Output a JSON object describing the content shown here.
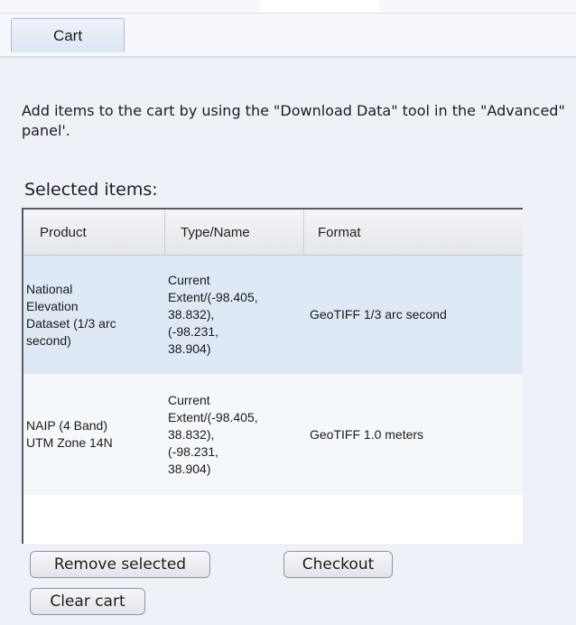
{
  "tabs": [
    {
      "label": "Cart",
      "active": true
    }
  ],
  "instructions": "Add items to the cart by using the \"Download Data\" tool in the \"Advanced\" panel'.",
  "selected_heading": "Selected items:",
  "grid": {
    "columns": [
      "Product",
      "Type/Name",
      "Format"
    ],
    "rows": [
      {
        "product": "National\nElevation\nDataset (1/3 arc\nsecond)",
        "type_name": "Current\nExtent/(-98.405,\n38.832),\n(-98.231,\n38.904)",
        "format": "GeoTIFF 1/3 arc second",
        "selected": true
      },
      {
        "product": "NAIP (4 Band)\nUTM Zone 14N",
        "type_name": "Current\nExtent/(-98.405,\n38.832),\n(-98.231,\n38.904)",
        "format": "GeoTIFF 1.0 meters",
        "selected": false
      }
    ]
  },
  "buttons": {
    "remove_selected": "Remove selected",
    "checkout": "Checkout",
    "clear_cart": "Clear cart"
  },
  "colors": {
    "selected_row": "#dde9f4",
    "background": "#eef1f7"
  }
}
